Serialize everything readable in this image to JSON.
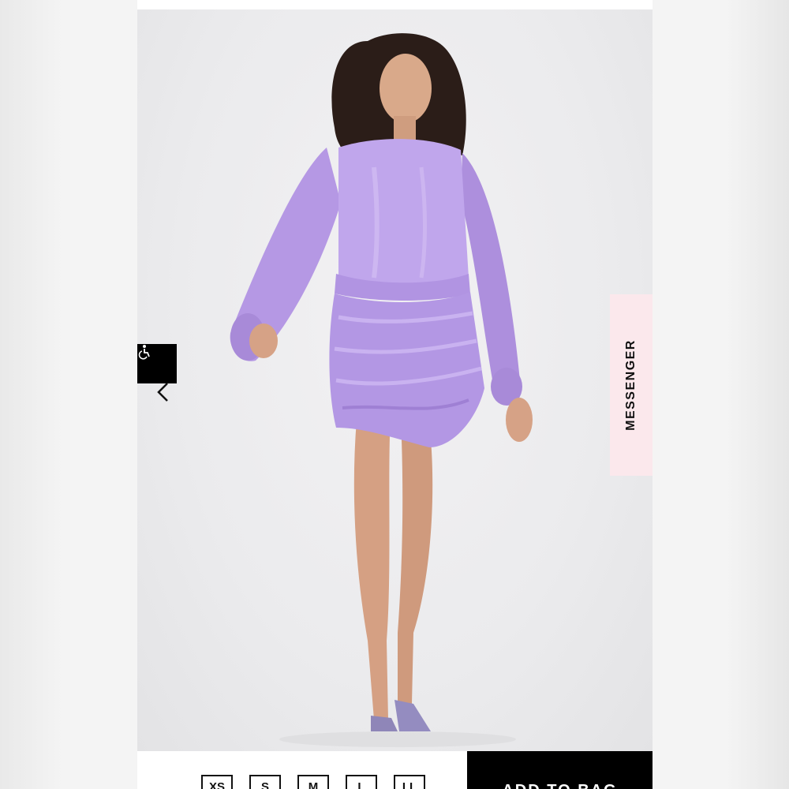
{
  "colors": {
    "accent_black": "#000000",
    "messenger_bg": "#fbe8ec",
    "dress": "#b79ce6"
  },
  "icons": {
    "accessibility": "accessibility-icon",
    "prev": "chevron-left-icon"
  },
  "messenger": {
    "label": "MESSENGER"
  },
  "sizes": [
    "XS",
    "S",
    "M",
    "L",
    "LL"
  ],
  "cta": {
    "label": "ADD TO BAG"
  }
}
